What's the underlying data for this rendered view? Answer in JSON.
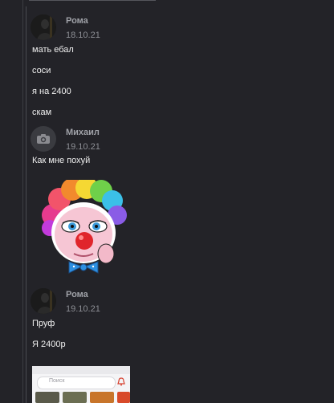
{
  "messages": [
    {
      "author": "Рома",
      "date": "18.10.21",
      "lines": [
        "мать ебал",
        "соси",
        "я на 2400",
        "скам"
      ]
    },
    {
      "author": "Михаил",
      "date": "19.10.21",
      "lines": [
        "Как мне похуй"
      ],
      "attachment": "sticker-clown"
    },
    {
      "author": "Рома",
      "date": "19.10.21",
      "lines": [
        "Пруф",
        "Я 2400р"
      ],
      "attachment": "screenshot",
      "screenshot_search_placeholder": "Поиск"
    }
  ],
  "colors": {
    "background": "#232328",
    "author": "#a0a2a8",
    "date": "#8d8f95",
    "text": "#f0f0f0"
  }
}
